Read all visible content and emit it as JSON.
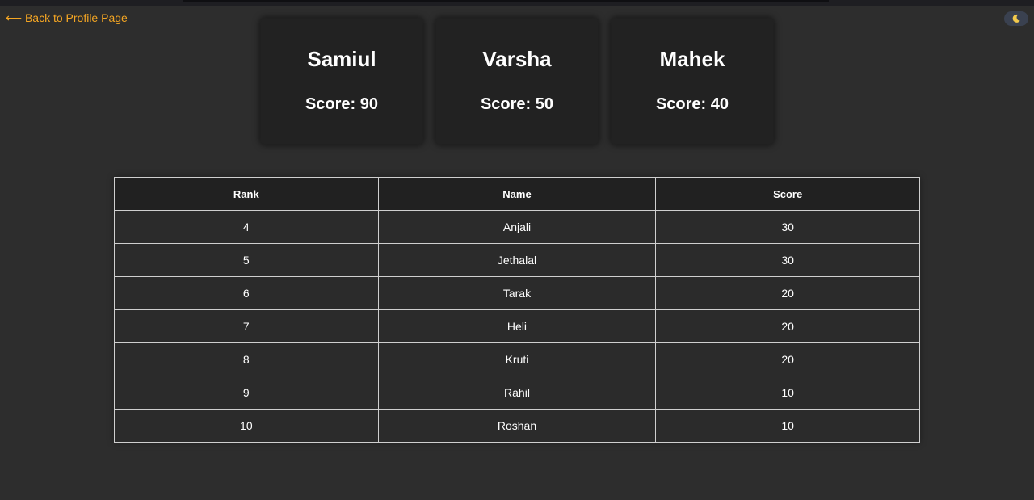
{
  "nav": {
    "back_label": "⟵ Back to Profile Page"
  },
  "theme_toggle": {
    "icon": "moon-icon",
    "mode": "dark"
  },
  "podium": [
    {
      "name": "Samiul",
      "score_label": "Score: 90"
    },
    {
      "name": "Varsha",
      "score_label": "Score: 50"
    },
    {
      "name": "Mahek",
      "score_label": "Score: 40"
    }
  ],
  "table": {
    "headers": {
      "rank": "Rank",
      "name": "Name",
      "score": "Score"
    },
    "rows": [
      {
        "rank": "4",
        "name": "Anjali",
        "score": "30"
      },
      {
        "rank": "5",
        "name": "Jethalal",
        "score": "30"
      },
      {
        "rank": "6",
        "name": "Tarak",
        "score": "20"
      },
      {
        "rank": "7",
        "name": "Heli",
        "score": "20"
      },
      {
        "rank": "8",
        "name": "Kruti",
        "score": "20"
      },
      {
        "rank": "9",
        "name": "Rahil",
        "score": "10"
      },
      {
        "rank": "10",
        "name": "Roshan",
        "score": "10"
      }
    ]
  },
  "colors": {
    "background": "#2d2d2d",
    "card": "#222222",
    "link": "#f5a623",
    "text": "#ffffff"
  }
}
